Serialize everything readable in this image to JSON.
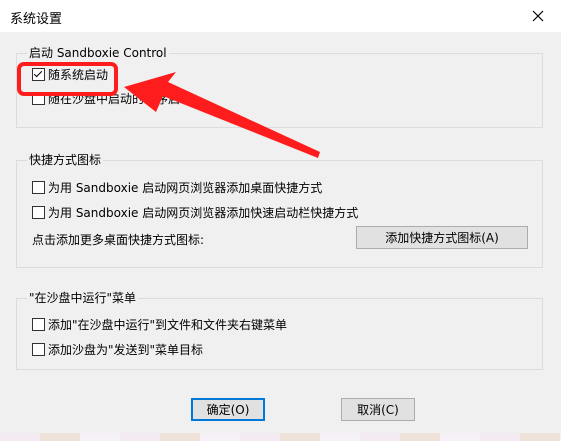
{
  "window": {
    "title": "系统设置",
    "close_icon": "close-icon"
  },
  "startup": {
    "legend": "启动 Sandboxie Control",
    "auto_start": {
      "label": "随系统启动",
      "checked": true
    },
    "sandbox_start": {
      "label": "随在沙盘中启动的程序启动",
      "checked": false
    }
  },
  "shortcuts": {
    "legend": "快捷方式图标",
    "desktop": {
      "label": "为用 Sandboxie 启动网页浏览器添加桌面快捷方式",
      "checked": false
    },
    "quicklaunch": {
      "label": "为用 Sandboxie 启动网页浏览器添加快速启动栏快捷方式",
      "checked": false
    },
    "more_text": "点击添加更多桌面快捷方式图标:",
    "add_button": "添加快捷方式图标(A)"
  },
  "run_in_sandbox": {
    "legend": "\"在沙盘中运行\"菜单",
    "context_menu": {
      "label": "添加\"在沙盘中运行\"到文件和文件夹右键菜单",
      "checked": false
    },
    "send_to": {
      "label": "添加沙盘为\"发送到\"菜单目标",
      "checked": false
    }
  },
  "footer": {
    "ok": "确定(O)",
    "cancel": "取消(C)"
  },
  "annotation": {
    "color": "#ff1c1c"
  }
}
